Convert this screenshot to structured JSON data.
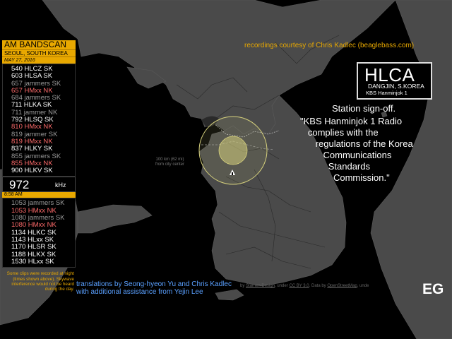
{
  "credit_top": "recordings courtesy of Chris Kadlec (beaglebass.com)",
  "bandscan": {
    "title": "AM BANDSCAN",
    "location": "SEOUL, SOUTH KOREA",
    "date": "MAY 27, 2016",
    "upper_items": [
      {
        "label": "540 HLCZ SK",
        "color": "white"
      },
      {
        "label": "603 HLSA SK",
        "color": "white"
      },
      {
        "label": "657 jammers SK",
        "color": "gray"
      },
      {
        "label": "657 HMxx NK",
        "color": "red"
      },
      {
        "label": "684 jammers SK",
        "color": "gray"
      },
      {
        "label": "711 HLKA SK",
        "color": "white"
      },
      {
        "label": "711 jammer NK",
        "color": "gray"
      },
      {
        "label": "792 HLSQ SK",
        "color": "white"
      },
      {
        "label": "810 HMxx NK",
        "color": "red"
      },
      {
        "label": "819 jammer SK",
        "color": "gray"
      },
      {
        "label": "819 HMxx NK",
        "color": "red"
      },
      {
        "label": "837 HLKY SK",
        "color": "white"
      },
      {
        "label": "855 jammers SK",
        "color": "gray"
      },
      {
        "label": "855 HMxx NK",
        "color": "red"
      },
      {
        "label": "900 HLKV SK",
        "color": "white"
      }
    ],
    "current_frequency": "972",
    "unit": "kHz",
    "time": "8:58 AM",
    "lower_items": [
      {
        "label": "1053 jammers SK",
        "color": "gray"
      },
      {
        "label": "1053 HMxx NK",
        "color": "red"
      },
      {
        "label": "1080 jammers SK",
        "color": "gray"
      },
      {
        "label": "1080 HMxx NK",
        "color": "red"
      },
      {
        "label": "1134 HLKC SK",
        "color": "white"
      },
      {
        "label": "1143 HLxx SK",
        "color": "white"
      },
      {
        "label": "1170 HLSR SK",
        "color": "white"
      },
      {
        "label": "1188 HLKX SK",
        "color": "white"
      },
      {
        "label": "1530 HLxx SK",
        "color": "white"
      }
    ],
    "note": "Some clips were recorded at night (times shown above). Skywave interference would not be heard during the day."
  },
  "station": {
    "callsign": "HLCA",
    "city": "DANGJIN, S.KOREA",
    "network": "KBS Hanminjok 1"
  },
  "description": "Station sign-off.",
  "quote_lines": [
    "\"KBS Hanminjok 1 Radio",
    "   complies with the",
    "      regulations of the Korea",
    "         Communications",
    "           Standards",
    "             Commission.\""
  ],
  "map": {
    "circle_label_line1": "100 km (62 mi)",
    "circle_label_line2": "from city center",
    "attribution_prefix": "by",
    "attribution_1": "Stamen Design",
    "attribution_2": ", under",
    "attribution_3": "CC BY 3.0",
    "attribution_4": ". Data by",
    "attribution_5": "OpenStreetMap",
    "attribution_6": ", unde"
  },
  "translations": {
    "line1": "translations by Seong-hyeon Yu and Chris Kadlec",
    "line2": "with additional assistance from Yejin Lee"
  },
  "logo": "EG",
  "colors": {
    "accent": "#e8a800",
    "land": "#4a4a4a",
    "sea": "#000000",
    "credit_blue": "#5aa0ff",
    "nk_red": "#ff6b6b"
  }
}
